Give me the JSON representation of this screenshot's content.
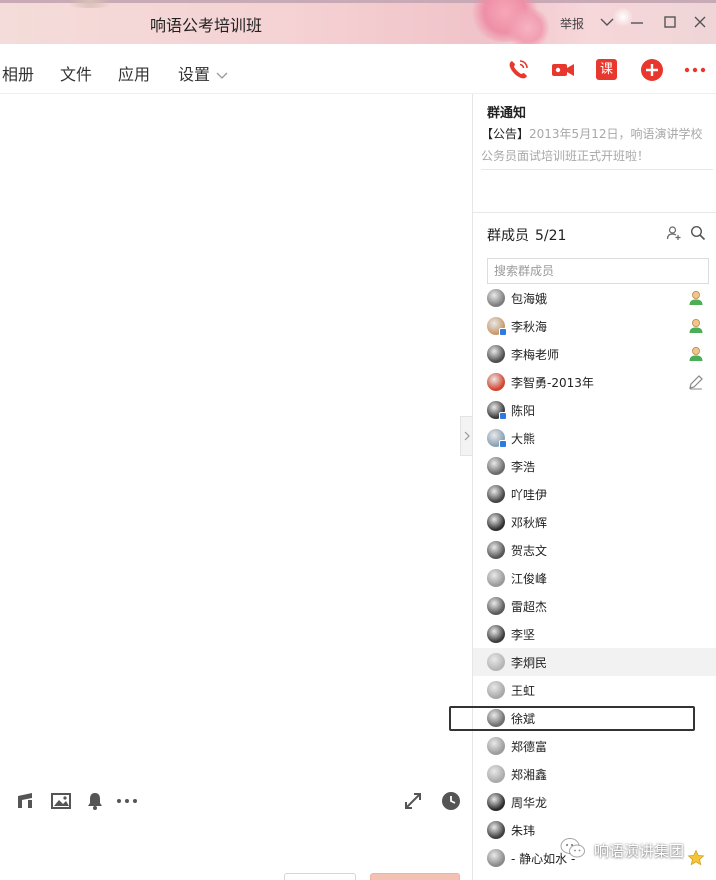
{
  "window": {
    "title": "响语公考培训班",
    "report_label": "举报",
    "controls": [
      "chevron-down-icon",
      "minimize-icon",
      "maximize-icon",
      "close-icon"
    ]
  },
  "toolbar": {
    "tabs": [
      {
        "label": "相册"
      },
      {
        "label": "文件"
      },
      {
        "label": "应用"
      },
      {
        "label": "设置"
      }
    ],
    "course_label": "课",
    "accent_color": "#e8372c"
  },
  "notice": {
    "title": "群通知",
    "tag": "【公告】",
    "text": "2013年5月12日，响语演讲学校公务员面试培训班正式开班啦！"
  },
  "members": {
    "title": "群成员",
    "count": "5/21",
    "search_placeholder": "搜索群成员",
    "list": [
      {
        "name": "包海娥",
        "role": "admin"
      },
      {
        "name": "李秋海",
        "role": "admin"
      },
      {
        "name": "李梅老师",
        "role": "admin"
      },
      {
        "name": "李智勇-2013年",
        "role": "edit"
      },
      {
        "name": "陈阳"
      },
      {
        "name": "大熊"
      },
      {
        "name": "李浩"
      },
      {
        "name": "吖哇伊"
      },
      {
        "name": "邓秋辉"
      },
      {
        "name": "贺志文"
      },
      {
        "name": "江俊峰"
      },
      {
        "name": "雷超杰"
      },
      {
        "name": "李坚"
      },
      {
        "name": "李炯民"
      },
      {
        "name": "王虹"
      },
      {
        "name": "徐斌"
      },
      {
        "name": "郑德富"
      },
      {
        "name": "郑湘鑫"
      },
      {
        "name": "周华龙"
      },
      {
        "name": "朱玮"
      },
      {
        "name": "- 静心如水 -",
        "role": "star"
      }
    ]
  },
  "watermark": {
    "text": "响语演讲集团"
  }
}
